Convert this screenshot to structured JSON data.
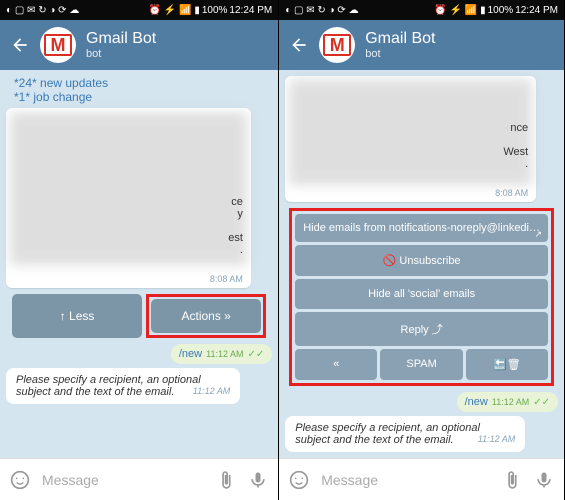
{
  "statusbar": {
    "battery": "100%",
    "time": "12:24 PM",
    "left_icons": "◐ ▢ ✉ ↻ ◑ ⟳ ☁",
    "right_icons": "⏰ ⚡ 📶 ▮"
  },
  "header": {
    "title": "Gmail Bot",
    "subtitle": "bot"
  },
  "left": {
    "updates_line1": "*24* new updates",
    "updates_line2": "*1* job change",
    "visible1": "ce",
    "visible2": "y",
    "visible3": "est",
    "visible4": ".",
    "msg_time": "8:08 AM",
    "btn_less": "↑ Less",
    "btn_actions": "Actions »",
    "cmd": "/new",
    "cmd_time": "11:12 AM",
    "specify": "Please specify a recipient, an optional subject and the text of the email.",
    "specify_time": "11:12 AM"
  },
  "right": {
    "visible1": "nce",
    "visible2": "West",
    "visible3": ".",
    "msg_time": "8:08 AM",
    "panel_title": "Hide emails from notifications-noreply@linkedi…",
    "btn_unsub": "🚫 Unsubscribe",
    "btn_hide": "Hide all 'social' emails",
    "btn_reply": "Reply ⤴",
    "btn_back": "«",
    "btn_spam": "SPAM",
    "btn_trash": "🔙🗑",
    "cmd": "/new",
    "cmd_time": "11:12 AM",
    "specify": "Please specify a recipient, an optional subject and the text of the email.",
    "specify_time": "11:12 AM"
  },
  "input": {
    "placeholder": "Message"
  }
}
